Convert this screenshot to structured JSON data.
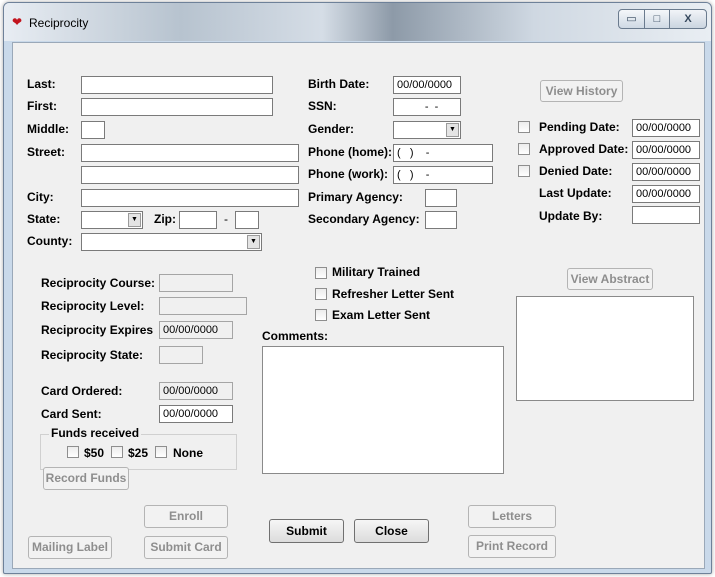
{
  "window": {
    "title": "Reciprocity",
    "icon": "heart-icon",
    "caption_buttons": {
      "minimize": "▭",
      "maximize": "□",
      "close": "X"
    }
  },
  "personal": {
    "last_label": "Last:",
    "first_label": "First:",
    "middle_label": "Middle:",
    "street_label": "Street:",
    "city_label": "City:",
    "state_label": "State:",
    "zip_label": "Zip:",
    "zip_separator": "-",
    "county_label": "County:",
    "birth_date_label": "Birth Date:",
    "birth_date_value": "00/00/0000",
    "ssn_label": "SSN:",
    "ssn_value": "  -  -",
    "gender_label": "Gender:",
    "phone_home_label": "Phone (home):",
    "phone_home_value": "(   )    -",
    "phone_work_label": "Phone (work):",
    "phone_work_value": "(   )    -",
    "primary_agency_label": "Primary Agency:",
    "secondary_agency_label": "Secondary  Agency:"
  },
  "status": {
    "view_history_label": "View History",
    "pending_label": "Pending Date:",
    "pending_value": "00/00/0000",
    "approved_label": "Approved Date:",
    "approved_value": "00/00/0000",
    "denied_label": "Denied Date:",
    "denied_value": "00/00/0000",
    "last_update_label": "Last Update:",
    "last_update_value": "00/00/0000",
    "update_by_label": "Update By:"
  },
  "reciprocity": {
    "course_label": "Reciprocity Course:",
    "level_label": "Reciprocity Level:",
    "expires_label": "Reciprocity Expires",
    "expires_value": "00/00/0000",
    "state_label": "Reciprocity State:"
  },
  "flags": {
    "military_label": "Military Trained",
    "refresher_label": "Refresher Letter Sent",
    "exam_label": "Exam Letter Sent"
  },
  "comments_label": "Comments:",
  "view_abstract_label": "View Abstract",
  "card": {
    "ordered_label": "Card Ordered:",
    "ordered_value": "00/00/0000",
    "sent_label": "Card Sent:",
    "sent_value": "00/00/0000"
  },
  "funds": {
    "title": "Funds received",
    "opt_50": "$50",
    "opt_25": "$25",
    "opt_none": "None",
    "record_label": "Record Funds"
  },
  "buttons": {
    "enroll": "Enroll",
    "mailing_label": "Mailing Label",
    "submit_card": "Submit Card",
    "submit": "Submit",
    "close": "Close",
    "letters": "Letters",
    "print_record": "Print Record"
  }
}
